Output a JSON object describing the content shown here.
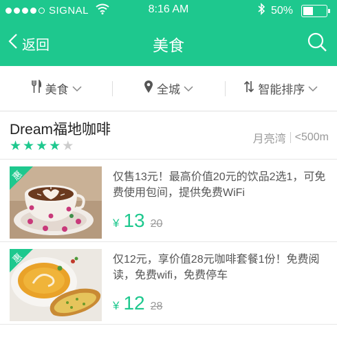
{
  "status_bar": {
    "carrier": "SIGNAL",
    "time": "8:16 AM",
    "battery_text": "50%",
    "battery_level": 0.5,
    "signal_bars": 4
  },
  "nav": {
    "back_label": "返回",
    "title": "美食",
    "search_icon": "search-icon",
    "back_icon": "chevron-left-icon"
  },
  "filters": [
    {
      "icon": "fork-knife-icon",
      "label": "美食"
    },
    {
      "icon": "location-pin-icon",
      "label": "全城"
    },
    {
      "icon": "sort-icon",
      "label": "智能排序"
    }
  ],
  "shop": {
    "name": "Dream福地咖啡",
    "rating": 4,
    "rating_max": 5,
    "area": "月亮湾",
    "distance": "<500m"
  },
  "deals": [
    {
      "badge": "惠",
      "description": "仅售13元！最高价值20元的饮品2选1，可免费使用包间，提供免费WiFi",
      "currency": "¥",
      "price": "13",
      "original_price": "20"
    },
    {
      "badge": "惠",
      "description": "仅12元，享价值28元咖啡套餐1份！免费阅读，免费wifi，免费停车",
      "currency": "¥",
      "price": "12",
      "original_price": "28"
    }
  ],
  "colors": {
    "accent": "#1ec88e",
    "text_primary": "#222222",
    "text_secondary": "#555555",
    "text_muted": "#999999"
  }
}
